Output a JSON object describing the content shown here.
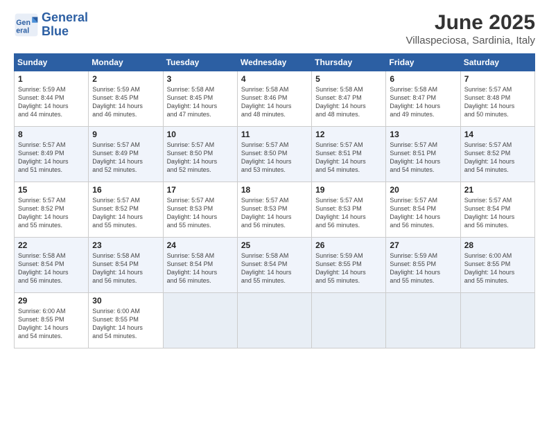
{
  "header": {
    "logo_line1": "General",
    "logo_line2": "Blue",
    "month_title": "June 2025",
    "location": "Villaspeciosa, Sardinia, Italy"
  },
  "weekdays": [
    "Sunday",
    "Monday",
    "Tuesday",
    "Wednesday",
    "Thursday",
    "Friday",
    "Saturday"
  ],
  "weeks": [
    [
      {
        "day": "1",
        "info": "Sunrise: 5:59 AM\nSunset: 8:44 PM\nDaylight: 14 hours\nand 44 minutes."
      },
      {
        "day": "2",
        "info": "Sunrise: 5:59 AM\nSunset: 8:45 PM\nDaylight: 14 hours\nand 46 minutes."
      },
      {
        "day": "3",
        "info": "Sunrise: 5:58 AM\nSunset: 8:45 PM\nDaylight: 14 hours\nand 47 minutes."
      },
      {
        "day": "4",
        "info": "Sunrise: 5:58 AM\nSunset: 8:46 PM\nDaylight: 14 hours\nand 48 minutes."
      },
      {
        "day": "5",
        "info": "Sunrise: 5:58 AM\nSunset: 8:47 PM\nDaylight: 14 hours\nand 48 minutes."
      },
      {
        "day": "6",
        "info": "Sunrise: 5:58 AM\nSunset: 8:47 PM\nDaylight: 14 hours\nand 49 minutes."
      },
      {
        "day": "7",
        "info": "Sunrise: 5:57 AM\nSunset: 8:48 PM\nDaylight: 14 hours\nand 50 minutes."
      }
    ],
    [
      {
        "day": "8",
        "info": "Sunrise: 5:57 AM\nSunset: 8:49 PM\nDaylight: 14 hours\nand 51 minutes."
      },
      {
        "day": "9",
        "info": "Sunrise: 5:57 AM\nSunset: 8:49 PM\nDaylight: 14 hours\nand 52 minutes."
      },
      {
        "day": "10",
        "info": "Sunrise: 5:57 AM\nSunset: 8:50 PM\nDaylight: 14 hours\nand 52 minutes."
      },
      {
        "day": "11",
        "info": "Sunrise: 5:57 AM\nSunset: 8:50 PM\nDaylight: 14 hours\nand 53 minutes."
      },
      {
        "day": "12",
        "info": "Sunrise: 5:57 AM\nSunset: 8:51 PM\nDaylight: 14 hours\nand 54 minutes."
      },
      {
        "day": "13",
        "info": "Sunrise: 5:57 AM\nSunset: 8:51 PM\nDaylight: 14 hours\nand 54 minutes."
      },
      {
        "day": "14",
        "info": "Sunrise: 5:57 AM\nSunset: 8:52 PM\nDaylight: 14 hours\nand 54 minutes."
      }
    ],
    [
      {
        "day": "15",
        "info": "Sunrise: 5:57 AM\nSunset: 8:52 PM\nDaylight: 14 hours\nand 55 minutes."
      },
      {
        "day": "16",
        "info": "Sunrise: 5:57 AM\nSunset: 8:52 PM\nDaylight: 14 hours\nand 55 minutes."
      },
      {
        "day": "17",
        "info": "Sunrise: 5:57 AM\nSunset: 8:53 PM\nDaylight: 14 hours\nand 55 minutes."
      },
      {
        "day": "18",
        "info": "Sunrise: 5:57 AM\nSunset: 8:53 PM\nDaylight: 14 hours\nand 56 minutes."
      },
      {
        "day": "19",
        "info": "Sunrise: 5:57 AM\nSunset: 8:53 PM\nDaylight: 14 hours\nand 56 minutes."
      },
      {
        "day": "20",
        "info": "Sunrise: 5:57 AM\nSunset: 8:54 PM\nDaylight: 14 hours\nand 56 minutes."
      },
      {
        "day": "21",
        "info": "Sunrise: 5:57 AM\nSunset: 8:54 PM\nDaylight: 14 hours\nand 56 minutes."
      }
    ],
    [
      {
        "day": "22",
        "info": "Sunrise: 5:58 AM\nSunset: 8:54 PM\nDaylight: 14 hours\nand 56 minutes."
      },
      {
        "day": "23",
        "info": "Sunrise: 5:58 AM\nSunset: 8:54 PM\nDaylight: 14 hours\nand 56 minutes."
      },
      {
        "day": "24",
        "info": "Sunrise: 5:58 AM\nSunset: 8:54 PM\nDaylight: 14 hours\nand 56 minutes."
      },
      {
        "day": "25",
        "info": "Sunrise: 5:58 AM\nSunset: 8:54 PM\nDaylight: 14 hours\nand 55 minutes."
      },
      {
        "day": "26",
        "info": "Sunrise: 5:59 AM\nSunset: 8:55 PM\nDaylight: 14 hours\nand 55 minutes."
      },
      {
        "day": "27",
        "info": "Sunrise: 5:59 AM\nSunset: 8:55 PM\nDaylight: 14 hours\nand 55 minutes."
      },
      {
        "day": "28",
        "info": "Sunrise: 6:00 AM\nSunset: 8:55 PM\nDaylight: 14 hours\nand 55 minutes."
      }
    ],
    [
      {
        "day": "29",
        "info": "Sunrise: 6:00 AM\nSunset: 8:55 PM\nDaylight: 14 hours\nand 54 minutes."
      },
      {
        "day": "30",
        "info": "Sunrise: 6:00 AM\nSunset: 8:55 PM\nDaylight: 14 hours\nand 54 minutes."
      },
      {
        "day": "",
        "info": ""
      },
      {
        "day": "",
        "info": ""
      },
      {
        "day": "",
        "info": ""
      },
      {
        "day": "",
        "info": ""
      },
      {
        "day": "",
        "info": ""
      }
    ]
  ]
}
